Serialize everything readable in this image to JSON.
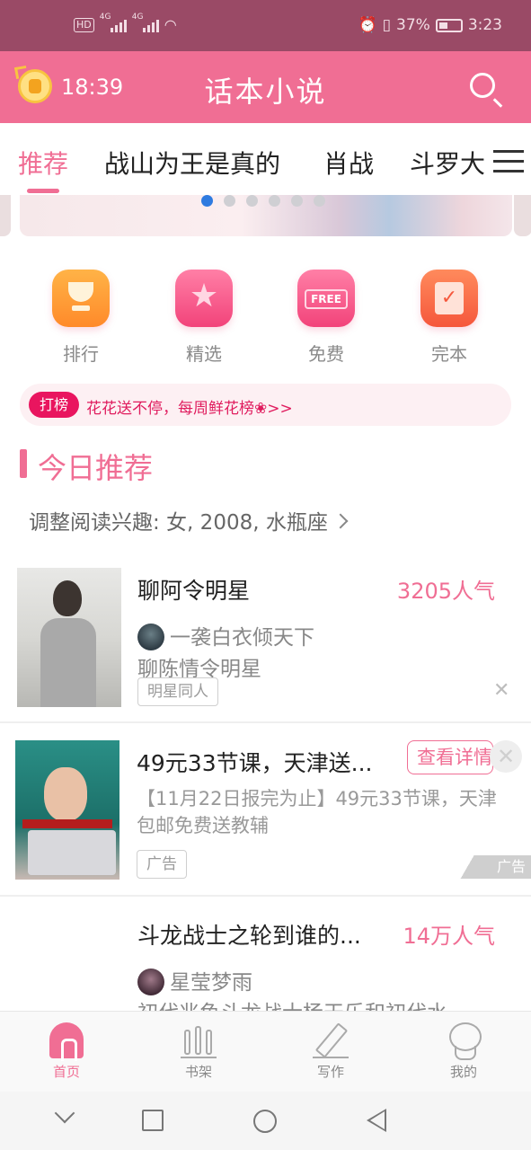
{
  "status_bar": {
    "network_badge": "HD",
    "signal1_label": "4G",
    "signal2_label": "4G",
    "battery_percent": "37%",
    "time": "3:23",
    "icons": [
      "hd-icon",
      "signal-icon",
      "wifi-icon",
      "alarm-icon",
      "vibrate-icon",
      "battery-icon"
    ]
  },
  "header": {
    "time": "18:39",
    "title": "话本小说",
    "left_icon": "alarm-coin-icon",
    "right_icon": "search-icon"
  },
  "tabs": [
    {
      "label": "推荐",
      "active": true
    },
    {
      "label": "战山为王是真的",
      "active": false
    },
    {
      "label": "肖战",
      "active": false
    },
    {
      "label": "斗罗大",
      "active": false
    }
  ],
  "banner": {
    "dots": 6,
    "active_dot": 0
  },
  "quick_entries": [
    {
      "label": "排行",
      "icon": "trophy-icon"
    },
    {
      "label": "精选",
      "icon": "star-icon"
    },
    {
      "label": "免费",
      "icon": "free-sign-icon",
      "icon_text": "FREE"
    },
    {
      "label": "完本",
      "icon": "checked-book-icon"
    }
  ],
  "flower_banner": {
    "badge": "打榜",
    "text": "花花送不停，每周鲜花榜❀>>"
  },
  "section": {
    "title": "今日推荐",
    "interest": "调整阅读兴趣: 女, 2008, 水瓶座"
  },
  "items": [
    {
      "title": "聊阿令明星",
      "popularity": "3205人气",
      "author": "一袭白衣倾天下",
      "desc": "聊陈情令明星",
      "tag": "明星同人"
    },
    {
      "title": "49元33节课，天津送...",
      "button": "查看详情",
      "desc": "【11月22日报完为止】49元33节课，天津包邮免费送教辅",
      "tag": "广告",
      "corner": "广告"
    },
    {
      "title": "斗龙战士之轮到谁的...",
      "popularity": "14万人气",
      "author": "星莹梦雨",
      "desc": "初代兆鱼斗龙战士杨天乐和初代水"
    }
  ],
  "bottom_nav": [
    {
      "label": "首页",
      "icon": "home-icon",
      "active": true
    },
    {
      "label": "书架",
      "icon": "bookshelf-icon",
      "active": false
    },
    {
      "label": "写作",
      "icon": "pen-icon",
      "active": false
    },
    {
      "label": "我的",
      "icon": "profile-icon",
      "active": false
    }
  ],
  "colors": {
    "status_bar": "#9a4a66",
    "brand": "#f06e94",
    "badge": "#e9155f"
  }
}
